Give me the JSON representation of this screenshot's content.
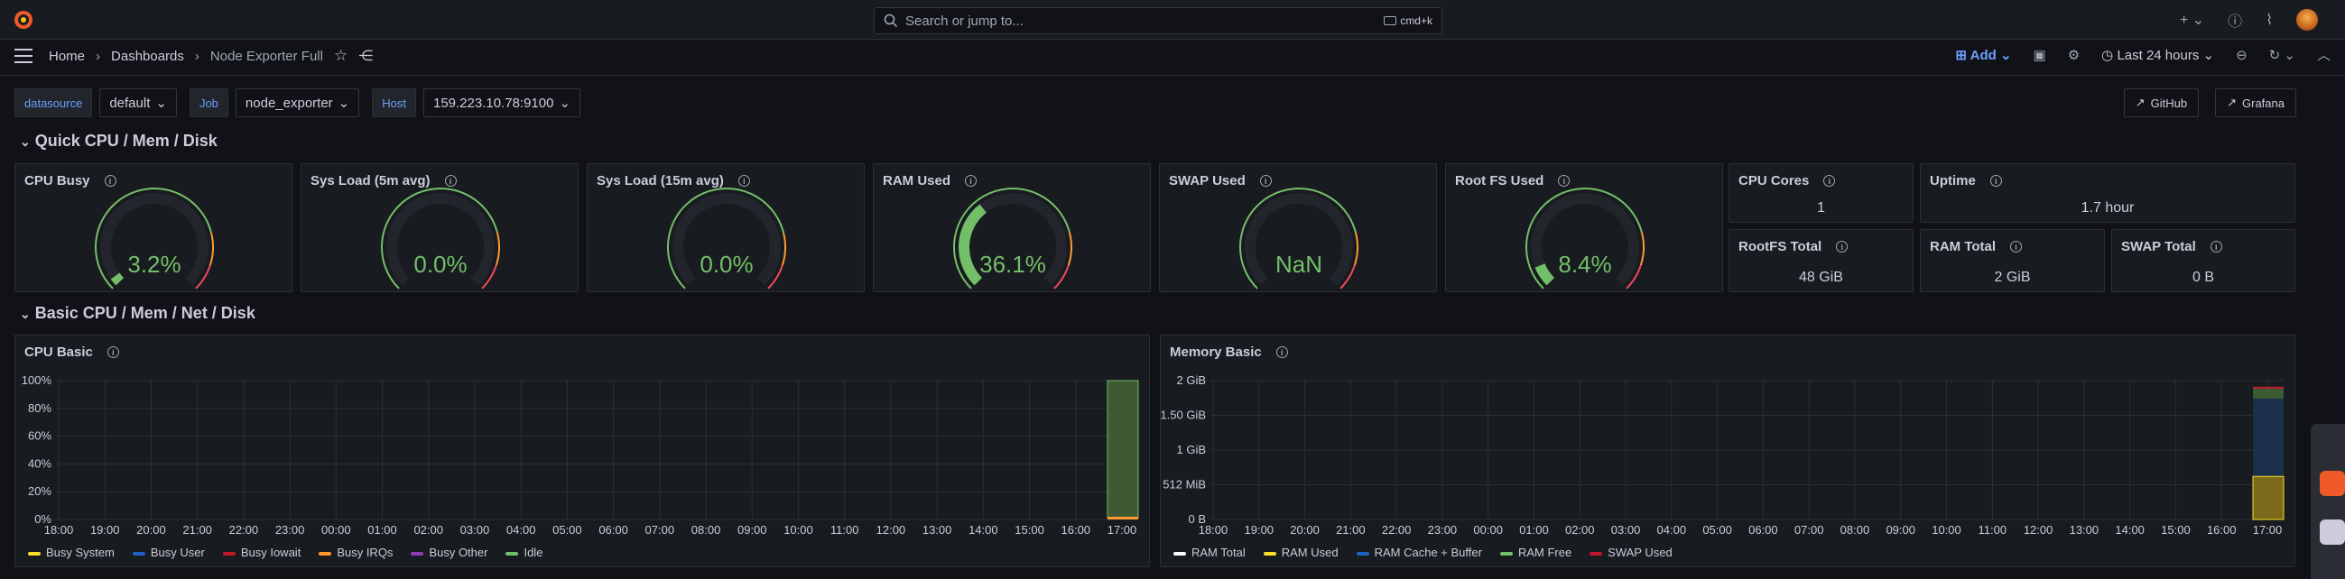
{
  "search": {
    "placeholder": "Search or jump to...",
    "shortcut": "cmd+k"
  },
  "breadcrumbs": {
    "home": "Home",
    "dashboards": "Dashboards",
    "current": "Node Exporter Full"
  },
  "toolbar": {
    "add_label": "Add",
    "time_range": "Last 24 hours"
  },
  "variables": [
    {
      "label": "datasource",
      "value": "default"
    },
    {
      "label": "Job",
      "value": "node_exporter"
    },
    {
      "label": "Host",
      "value": "159.223.10.78:9100"
    }
  ],
  "links": {
    "github": "GitHub",
    "grafana": "Grafana"
  },
  "rows": {
    "quick": "Quick CPU / Mem / Disk",
    "basic": "Basic CPU / Mem / Net / Disk"
  },
  "gauges": [
    {
      "title": "CPU Busy",
      "value": "3.2%",
      "fraction": 0.032,
      "color": "#73bf69"
    },
    {
      "title": "Sys Load (5m avg)",
      "value": "0.0%",
      "fraction": 0.0,
      "color": "#73bf69"
    },
    {
      "title": "Sys Load (15m avg)",
      "value": "0.0%",
      "fraction": 0.0,
      "color": "#73bf69"
    },
    {
      "title": "RAM Used",
      "value": "36.1%",
      "fraction": 0.361,
      "color": "#73bf69"
    },
    {
      "title": "SWAP Used",
      "value": "NaN",
      "fraction": 0.0,
      "color": "#73bf69"
    },
    {
      "title": "Root FS Used",
      "value": "8.4%",
      "fraction": 0.084,
      "color": "#73bf69"
    }
  ],
  "stats": {
    "cpu_cores": {
      "title": "CPU Cores",
      "value": "1"
    },
    "uptime": {
      "title": "Uptime",
      "value": "1.7 hour"
    },
    "rootfs_total": {
      "title": "RootFS Total",
      "value": "48 GiB"
    },
    "ram_total": {
      "title": "RAM Total",
      "value": "2 GiB"
    },
    "swap_total": {
      "title": "SWAP Total",
      "value": "0 B"
    }
  },
  "cpu_basic": {
    "title": "CPU Basic",
    "yticks": [
      "100%",
      "80%",
      "60%",
      "40%",
      "20%",
      "0%"
    ],
    "legend": [
      {
        "name": "Busy System",
        "color": "#fade2a"
      },
      {
        "name": "Busy User",
        "color": "#1f60c4"
      },
      {
        "name": "Busy Iowait",
        "color": "#c4162a"
      },
      {
        "name": "Busy IRQs",
        "color": "#ff9830"
      },
      {
        "name": "Busy Other",
        "color": "#8f3bb8"
      },
      {
        "name": "Idle",
        "color": "#73bf69"
      }
    ]
  },
  "memory_basic": {
    "title": "Memory Basic",
    "yticks": [
      "2 GiB",
      "1.50 GiB",
      "1 GiB",
      "512 MiB",
      "0 B"
    ],
    "legend": [
      {
        "name": "RAM Total",
        "color": "#ffffff"
      },
      {
        "name": "RAM Used",
        "color": "#fade2a"
      },
      {
        "name": "RAM Cache + Buffer",
        "color": "#1f60c4"
      },
      {
        "name": "RAM Free",
        "color": "#73bf69"
      },
      {
        "name": "SWAP Used",
        "color": "#c4162a"
      }
    ]
  },
  "xticks": [
    "18:00",
    "19:00",
    "20:00",
    "21:00",
    "22:00",
    "23:00",
    "00:00",
    "01:00",
    "02:00",
    "03:00",
    "04:00",
    "05:00",
    "06:00",
    "07:00",
    "08:00",
    "09:00",
    "10:00",
    "11:00",
    "12:00",
    "13:00",
    "14:00",
    "15:00",
    "16:00",
    "17:00"
  ]
}
